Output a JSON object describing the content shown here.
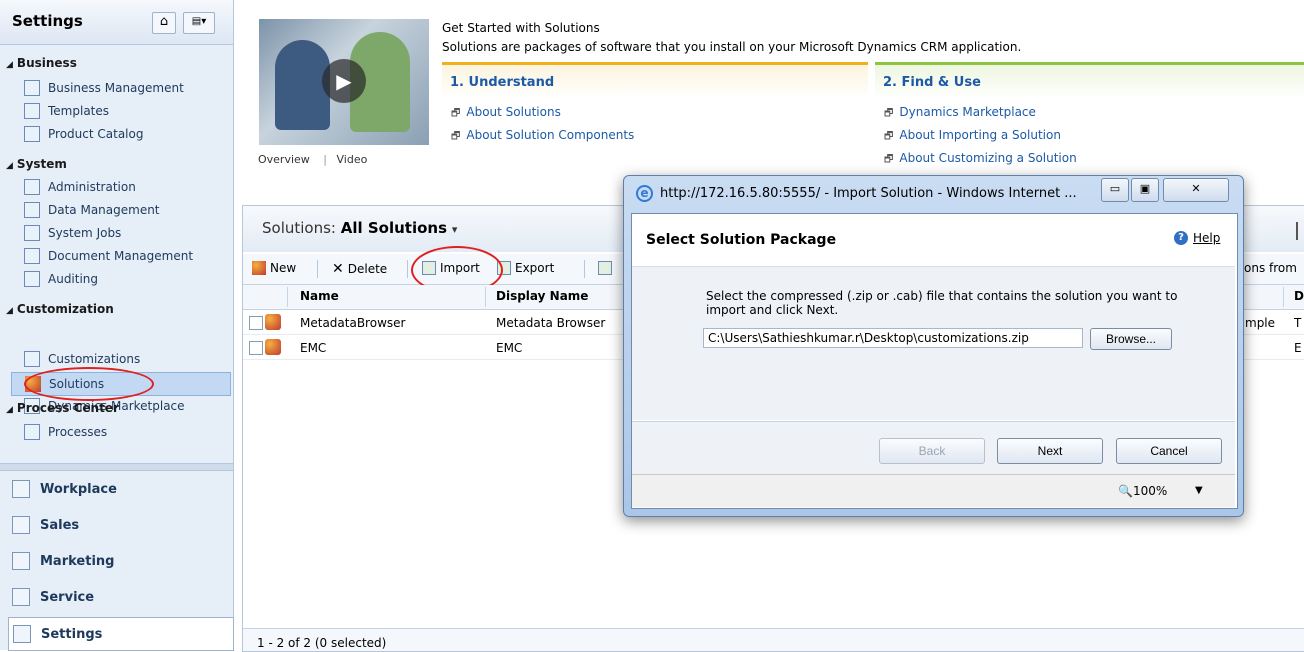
{
  "nav": {
    "title": "Settings",
    "groups": [
      {
        "label": "Business",
        "items": [
          "Business Management",
          "Templates",
          "Product Catalog"
        ]
      },
      {
        "label": "System",
        "items": [
          "Administration",
          "Data Management",
          "System Jobs",
          "Document Management",
          "Auditing"
        ]
      },
      {
        "label": "Customization",
        "items": [
          "Customizations",
          "Solutions",
          "Dynamics Marketplace"
        ]
      },
      {
        "label": "Process Center",
        "items": [
          "Processes"
        ]
      }
    ],
    "selected_item": "Solutions",
    "bottom": [
      "Workplace",
      "Sales",
      "Marketing",
      "Service",
      "Settings"
    ],
    "active_bottom": "Settings"
  },
  "get_started": {
    "title": "Get Started with Solutions",
    "description": "Solutions are packages of software that you install on your Microsoft Dynamics CRM application.",
    "tab_overview": "Overview",
    "tab_video": "Video",
    "col1": {
      "heading": "1. Understand",
      "links": [
        "About Solutions",
        "About Solution Components"
      ]
    },
    "col2": {
      "heading": "2. Find & Use",
      "links": [
        "Dynamics Marketplace",
        "About Importing a Solution",
        "About Customizing a Solution"
      ]
    },
    "accent1": "#f2b01e",
    "accent2": "#8cc63e"
  },
  "solutions": {
    "view_label": "Solutions:",
    "view_name": "All Solutions",
    "toolbar": {
      "new": "New",
      "delete": "Delete",
      "import": "Import",
      "export": "Export",
      "right_fragment": "ons from"
    },
    "columns": {
      "name": "Name",
      "display_name": "Display Name",
      "right": "D"
    },
    "rows": [
      {
        "name": "MetadataBrowser",
        "display_name": "Metadata Browser",
        "right_a": "mple",
        "right_b": "T"
      },
      {
        "name": "EMC",
        "display_name": "EMC",
        "right_a": "",
        "right_b": "E"
      }
    ],
    "status": "1 - 2 of 2 (0 selected)"
  },
  "popup": {
    "window_title": "http://172.16.5.80:5555/ - Import Solution - Windows Internet ...",
    "dialog_title": "Select Solution Package",
    "help": "Help",
    "instruction": "Select the compressed (.zip or .cab) file that contains the solution you want to import and click Next.",
    "file_value": "C:\\Users\\Sathieshkumar.r\\Desktop\\customizations.zip",
    "browse": "Browse...",
    "back": "Back",
    "next": "Next",
    "cancel": "Cancel",
    "zoom": "100%"
  }
}
